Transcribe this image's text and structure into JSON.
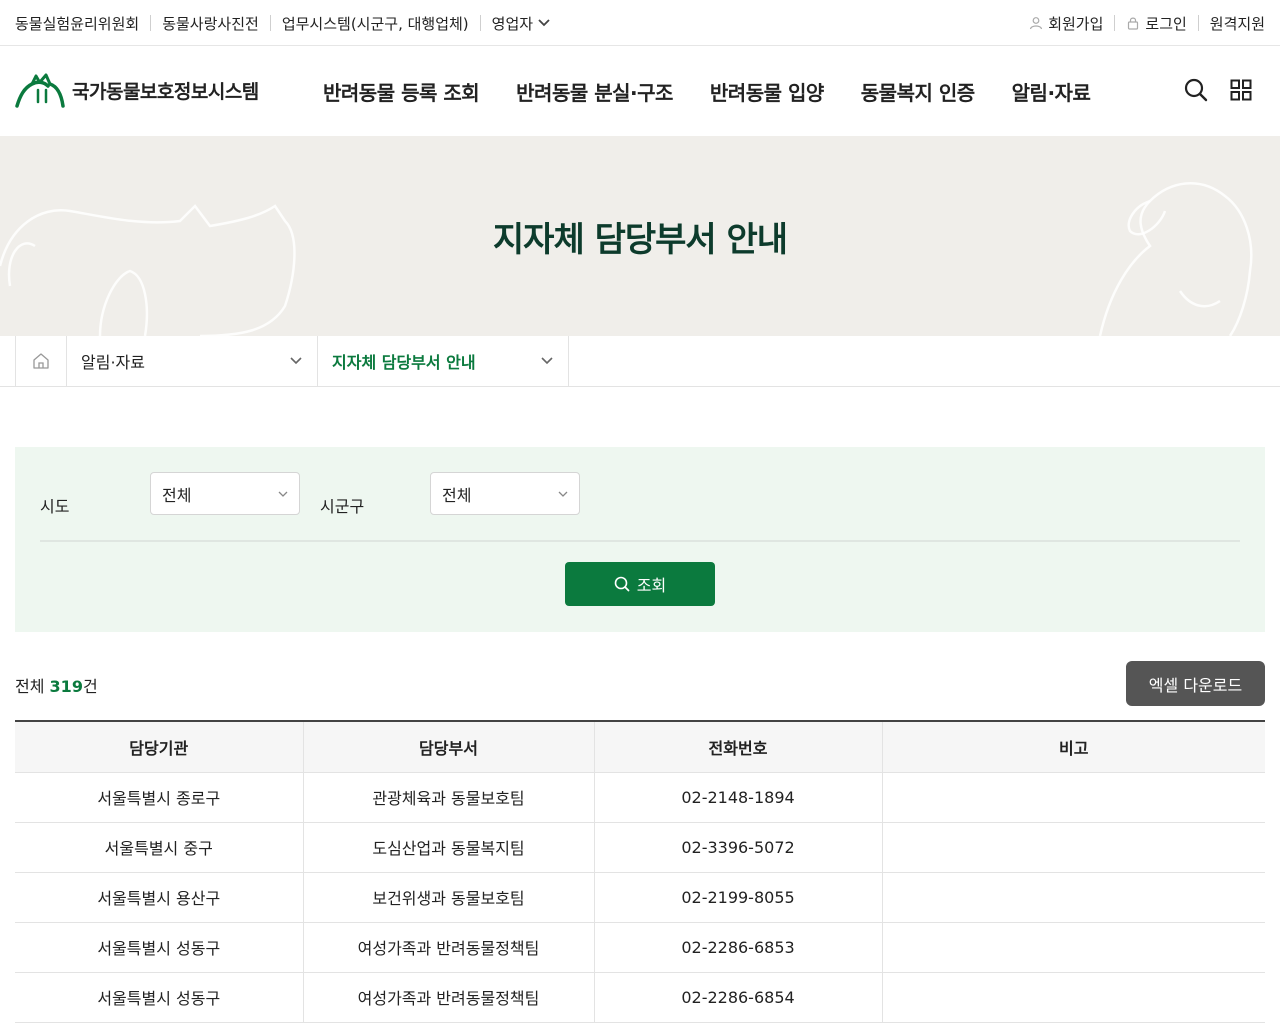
{
  "util": {
    "left_links": [
      "동물실험윤리위원회",
      "동물사랑사진전",
      "업무시스템(시군구, 대행업체)"
    ],
    "business_dropdown": "영업자",
    "signup": "회원가입",
    "login": "로그인",
    "remote": "원격지원"
  },
  "site": {
    "logo_text": "국가동물보호정보시스템",
    "brand_color": "#0b7a3e"
  },
  "menu": [
    "반려동물 등록 조회",
    "반려동물 분실·구조",
    "반려동물 입양",
    "동물복지 인증",
    "알림·자료"
  ],
  "hero": {
    "title": "지자체 담당부서 안내"
  },
  "breadcrumb": {
    "level1": "알림·자료",
    "level2": "지자체 담당부서 안내"
  },
  "search": {
    "sido_label": "시도",
    "sido_value": "전체",
    "sigungu_label": "시군구",
    "sigungu_value": "전체",
    "button_label": "조회"
  },
  "summary": {
    "prefix": "전체",
    "count": "319",
    "suffix": "건",
    "excel_label": "엑셀 다운로드"
  },
  "table": {
    "headers": [
      "담당기관",
      "담당부서",
      "전화번호",
      "비고"
    ],
    "rows": [
      [
        "서울특별시 종로구",
        "관광체육과 동물보호팀",
        "02-2148-1894",
        ""
      ],
      [
        "서울특별시 중구",
        "도심산업과 동물복지팀",
        "02-3396-5072",
        ""
      ],
      [
        "서울특별시 용산구",
        "보건위생과 동물보호팀",
        "02-2199-8055",
        ""
      ],
      [
        "서울특별시 성동구",
        "여성가족과 반려동물정책팀",
        "02-2286-6853",
        ""
      ],
      [
        "서울특별시 성동구",
        "여성가족과 반려동물정책팀",
        "02-2286-6854",
        ""
      ]
    ]
  }
}
